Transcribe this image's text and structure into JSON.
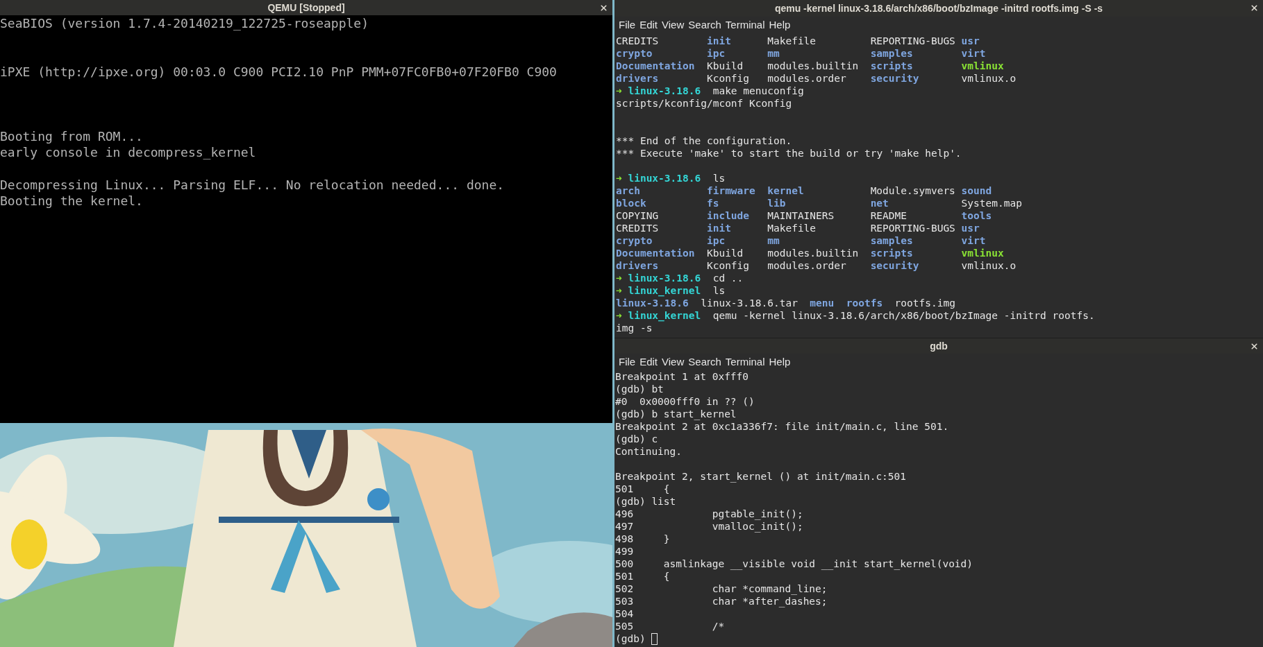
{
  "qemu_window": {
    "title": "QEMU [Stopped]",
    "screen_lines": [
      {
        "kind": "text",
        "text": "SeaBIOS (version 1.7.4-20140219_122725-roseapple)"
      },
      {
        "kind": "blank"
      },
      {
        "kind": "blank"
      },
      {
        "kind": "text",
        "text": "iPXE (http://ipxe.org) 00:03.0 C900 PCI2.10 PnP PMM+07FC0FB0+07F20FB0 C900"
      },
      {
        "kind": "blank"
      },
      {
        "kind": "blank"
      },
      {
        "kind": "blank"
      },
      {
        "kind": "text",
        "text": "Booting from ROM..."
      },
      {
        "kind": "text",
        "text": "early console in decompress_kernel"
      },
      {
        "kind": "blank"
      },
      {
        "kind": "text",
        "text": "Decompressing Linux... Parsing ELF... No relocation needed... done."
      },
      {
        "kind": "text",
        "text": "Booting the kernel."
      }
    ]
  },
  "terminal_window": {
    "title": "qemu -kernel linux-3.18.6/arch/x86/boot/bzImage -initrd rootfs.img -S -s",
    "menu": [
      "File",
      "Edit",
      "View",
      "Search",
      "Terminal",
      "Help"
    ],
    "lines": [
      {
        "kind": "ls",
        "cells": [
          {
            "text": "CREDITS",
            "kind": "file"
          },
          {
            "text": "init",
            "kind": "dir"
          },
          {
            "text": "Makefile",
            "kind": "file"
          },
          {
            "text": "REPORTING-BUGS",
            "kind": "file"
          },
          {
            "text": "usr",
            "kind": "dir"
          }
        ]
      },
      {
        "kind": "ls",
        "cells": [
          {
            "text": "crypto",
            "kind": "dir"
          },
          {
            "text": "ipc",
            "kind": "dir"
          },
          {
            "text": "mm",
            "kind": "dir"
          },
          {
            "text": "samples",
            "kind": "dir"
          },
          {
            "text": "virt",
            "kind": "dir"
          }
        ]
      },
      {
        "kind": "ls",
        "cells": [
          {
            "text": "Documentation",
            "kind": "dir"
          },
          {
            "text": "Kbuild",
            "kind": "file"
          },
          {
            "text": "modules.builtin",
            "kind": "file"
          },
          {
            "text": "scripts",
            "kind": "dir"
          },
          {
            "text": "vmlinux",
            "kind": "exec"
          }
        ]
      },
      {
        "kind": "ls",
        "cells": [
          {
            "text": "drivers",
            "kind": "dir"
          },
          {
            "text": "Kconfig",
            "kind": "file"
          },
          {
            "text": "modules.order",
            "kind": "file"
          },
          {
            "text": "security",
            "kind": "dir"
          },
          {
            "text": "vmlinux.o",
            "kind": "file"
          }
        ]
      },
      {
        "kind": "prompt",
        "arrow": "➜",
        "dir": "linux-3.18.6",
        "command": "make menuconfig"
      },
      {
        "kind": "text",
        "text": "scripts/kconfig/mconf Kconfig"
      },
      {
        "kind": "blank"
      },
      {
        "kind": "blank"
      },
      {
        "kind": "text",
        "text": "*** End of the configuration."
      },
      {
        "kind": "text",
        "text": "*** Execute 'make' to start the build or try 'make help'."
      },
      {
        "kind": "blank"
      },
      {
        "kind": "prompt",
        "arrow": "➜",
        "dir": "linux-3.18.6",
        "command": "ls"
      },
      {
        "kind": "ls",
        "cells": [
          {
            "text": "arch",
            "kind": "dir"
          },
          {
            "text": "firmware",
            "kind": "dir"
          },
          {
            "text": "kernel",
            "kind": "dir"
          },
          {
            "text": "Module.symvers",
            "kind": "file"
          },
          {
            "text": "sound",
            "kind": "dir"
          }
        ]
      },
      {
        "kind": "ls",
        "cells": [
          {
            "text": "block",
            "kind": "dir"
          },
          {
            "text": "fs",
            "kind": "dir"
          },
          {
            "text": "lib",
            "kind": "dir"
          },
          {
            "text": "net",
            "kind": "dir"
          },
          {
            "text": "System.map",
            "kind": "file"
          }
        ]
      },
      {
        "kind": "ls",
        "cells": [
          {
            "text": "COPYING",
            "kind": "file"
          },
          {
            "text": "include",
            "kind": "dir"
          },
          {
            "text": "MAINTAINERS",
            "kind": "file"
          },
          {
            "text": "README",
            "kind": "file"
          },
          {
            "text": "tools",
            "kind": "dir"
          }
        ]
      },
      {
        "kind": "ls",
        "cells": [
          {
            "text": "CREDITS",
            "kind": "file"
          },
          {
            "text": "init",
            "kind": "dir"
          },
          {
            "text": "Makefile",
            "kind": "file"
          },
          {
            "text": "REPORTING-BUGS",
            "kind": "file"
          },
          {
            "text": "usr",
            "kind": "dir"
          }
        ]
      },
      {
        "kind": "ls",
        "cells": [
          {
            "text": "crypto",
            "kind": "dir"
          },
          {
            "text": "ipc",
            "kind": "dir"
          },
          {
            "text": "mm",
            "kind": "dir"
          },
          {
            "text": "samples",
            "kind": "dir"
          },
          {
            "text": "virt",
            "kind": "dir"
          }
        ]
      },
      {
        "kind": "ls",
        "cells": [
          {
            "text": "Documentation",
            "kind": "dir"
          },
          {
            "text": "Kbuild",
            "kind": "file"
          },
          {
            "text": "modules.builtin",
            "kind": "file"
          },
          {
            "text": "scripts",
            "kind": "dir"
          },
          {
            "text": "vmlinux",
            "kind": "exec"
          }
        ]
      },
      {
        "kind": "ls",
        "cells": [
          {
            "text": "drivers",
            "kind": "dir"
          },
          {
            "text": "Kconfig",
            "kind": "file"
          },
          {
            "text": "modules.order",
            "kind": "file"
          },
          {
            "text": "security",
            "kind": "dir"
          },
          {
            "text": "vmlinux.o",
            "kind": "file"
          }
        ]
      },
      {
        "kind": "prompt",
        "arrow": "➜",
        "dir": "linux-3.18.6",
        "command": "cd .."
      },
      {
        "kind": "prompt",
        "arrow": "➜",
        "dir": "linux_kernel",
        "command": "ls"
      },
      {
        "kind": "ls_inline",
        "cells": [
          {
            "text": "linux-3.18.6",
            "kind": "dir"
          },
          {
            "text": "linux-3.18.6.tar",
            "kind": "file"
          },
          {
            "text": "menu",
            "kind": "dir"
          },
          {
            "text": "rootfs",
            "kind": "dir"
          },
          {
            "text": "rootfs.img",
            "kind": "file"
          }
        ]
      },
      {
        "kind": "prompt",
        "arrow": "➜",
        "dir": "linux_kernel",
        "command": "qemu -kernel linux-3.18.6/arch/x86/boot/bzImage -initrd rootfs."
      },
      {
        "kind": "text",
        "text": "img -s"
      }
    ]
  },
  "gdb_window": {
    "title": "gdb",
    "menu": [
      "File",
      "Edit",
      "View",
      "Search",
      "Terminal",
      "Help"
    ],
    "lines": [
      {
        "kind": "text",
        "text": "Breakpoint 1 at 0xfff0"
      },
      {
        "kind": "text",
        "text": "(gdb) bt"
      },
      {
        "kind": "text",
        "text": "#0  0x0000fff0 in ?? ()"
      },
      {
        "kind": "text",
        "text": "(gdb) b start_kernel"
      },
      {
        "kind": "text",
        "text": "Breakpoint 2 at 0xc1a336f7: file init/main.c, line 501."
      },
      {
        "kind": "text",
        "text": "(gdb) c"
      },
      {
        "kind": "text",
        "text": "Continuing."
      },
      {
        "kind": "blank"
      },
      {
        "kind": "text",
        "text": "Breakpoint 2, start_kernel () at init/main.c:501"
      },
      {
        "kind": "source",
        "text": "501\t{"
      },
      {
        "kind": "text",
        "text": "(gdb) list"
      },
      {
        "kind": "source",
        "text": "496\t\tpgtable_init();"
      },
      {
        "kind": "source",
        "text": "497\t\tvmalloc_init();"
      },
      {
        "kind": "source",
        "text": "498\t}"
      },
      {
        "kind": "source",
        "text": "499"
      },
      {
        "kind": "source",
        "text": "500\tasmlinkage __visible void __init start_kernel(void)"
      },
      {
        "kind": "source",
        "text": "501\t{"
      },
      {
        "kind": "source",
        "text": "502\t\tchar *command_line;"
      },
      {
        "kind": "source",
        "text": "503\t\tchar *after_dashes;"
      },
      {
        "kind": "source",
        "text": "504"
      },
      {
        "kind": "source",
        "text": "505\t\t/*"
      },
      {
        "kind": "input",
        "prompt": "(gdb)"
      }
    ]
  }
}
